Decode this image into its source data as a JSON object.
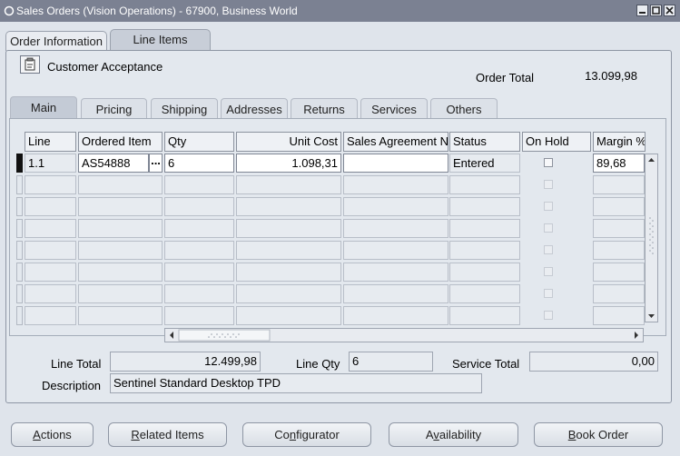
{
  "window": {
    "title": "Sales Orders (Vision Operations) - 67900, Business World"
  },
  "window_tabs": [
    {
      "label": "Order Information",
      "active": false
    },
    {
      "label": "Line Items",
      "active": true
    }
  ],
  "header": {
    "customer_acceptance_label": "Customer Acceptance",
    "order_total_label": "Order Total",
    "order_total_value": "13.099,98"
  },
  "sub_tabs": [
    {
      "label": "Main",
      "active": true
    },
    {
      "label": "Pricing",
      "active": false
    },
    {
      "label": "Shipping",
      "active": false
    },
    {
      "label": "Addresses",
      "active": false
    },
    {
      "label": "Returns",
      "active": false
    },
    {
      "label": "Services",
      "active": false
    },
    {
      "label": "Others",
      "active": false
    }
  ],
  "grid": {
    "columns": [
      "Line",
      "Ordered Item",
      "Qty",
      "Unit Cost",
      "Sales Agreement Number",
      "Status",
      "On Hold",
      "Margin %"
    ],
    "rows": [
      {
        "line": "1.1",
        "ordered_item": "AS54888",
        "qty": "6",
        "unit_cost": "1.098,31",
        "sales_agreement": "",
        "status": "Entered",
        "on_hold": false,
        "margin": "89,68"
      }
    ],
    "empty_row_count": 7,
    "lov_button_label": "..."
  },
  "footer": {
    "line_total_label": "Line Total",
    "line_total_value": "12.499,98",
    "line_qty_label": "Line Qty",
    "line_qty_value": "6",
    "service_total_label": "Service Total",
    "service_total_value": "0,00",
    "description_label": "Description",
    "description_value": "Sentinel Standard Desktop TPD"
  },
  "buttons": [
    {
      "name": "actions-button",
      "label": "Actions",
      "mnemonic": "A"
    },
    {
      "name": "related-items-button",
      "label": "Related Items",
      "mnemonic": "R"
    },
    {
      "name": "configurator-button",
      "label": "Configurator",
      "mnemonic": "n"
    },
    {
      "name": "availability-button",
      "label": "Availability",
      "mnemonic": "v"
    },
    {
      "name": "book-order-button",
      "label": "Book Order",
      "mnemonic": "B"
    }
  ],
  "colors": {
    "titlebar": "#7b8192",
    "selection": "#2f3348",
    "background": "#dfe4eb"
  },
  "icons": {
    "window": "window-icon",
    "customer_acceptance": "clipboard-icon",
    "minimize": "minimize-icon",
    "maximize": "maximize-icon",
    "close": "close-icon"
  }
}
